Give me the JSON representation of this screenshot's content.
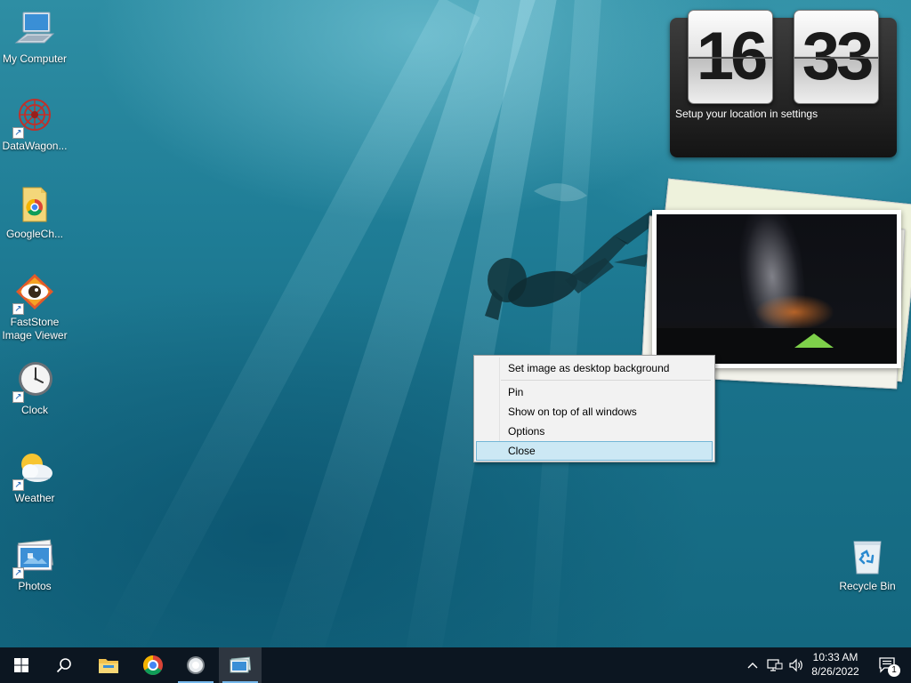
{
  "desktop_icons": [
    {
      "label": "My Computer",
      "icon": "computer-icon",
      "shortcut": false
    },
    {
      "label": "DataWagon...",
      "icon": "datawagon-icon",
      "shortcut": true
    },
    {
      "label": "GoogleCh...",
      "icon": "google-chrome-folder-icon",
      "shortcut": false
    },
    {
      "label": "FastStone Image Viewer",
      "icon": "faststone-eye-icon",
      "shortcut": true
    },
    {
      "label": "Clock",
      "icon": "clock-icon",
      "shortcut": true
    },
    {
      "label": "Weather",
      "icon": "weather-icon",
      "shortcut": true
    },
    {
      "label": "Photos",
      "icon": "photos-icon",
      "shortcut": true
    },
    {
      "label": "Recycle Bin",
      "icon": "recycle-bin-icon",
      "shortcut": false
    }
  ],
  "clock_gadget": {
    "hours": "16",
    "minutes": "33",
    "location_text": "Setup your location in settings"
  },
  "context_menu": {
    "items": [
      {
        "label": "Set image as desktop background",
        "highlighted": false
      },
      {
        "label": "Pin",
        "highlighted": false
      },
      {
        "label": "Show on top of all windows",
        "highlighted": false
      },
      {
        "label": "Options",
        "highlighted": false
      },
      {
        "label": "Close",
        "highlighted": true
      }
    ]
  },
  "taskbar": {
    "buttons": [
      "start-icon",
      "search-icon",
      "file-explorer-icon",
      "chrome-icon",
      "gadget-icon",
      "slideshow-icon"
    ],
    "tray": {
      "time": "10:33 AM",
      "date": "8/26/2022",
      "notification_count": "1"
    }
  },
  "colors": {
    "taskbar": "#0c1621",
    "menu_highlight": "#cce8f4",
    "accent": "#76b9ed"
  }
}
